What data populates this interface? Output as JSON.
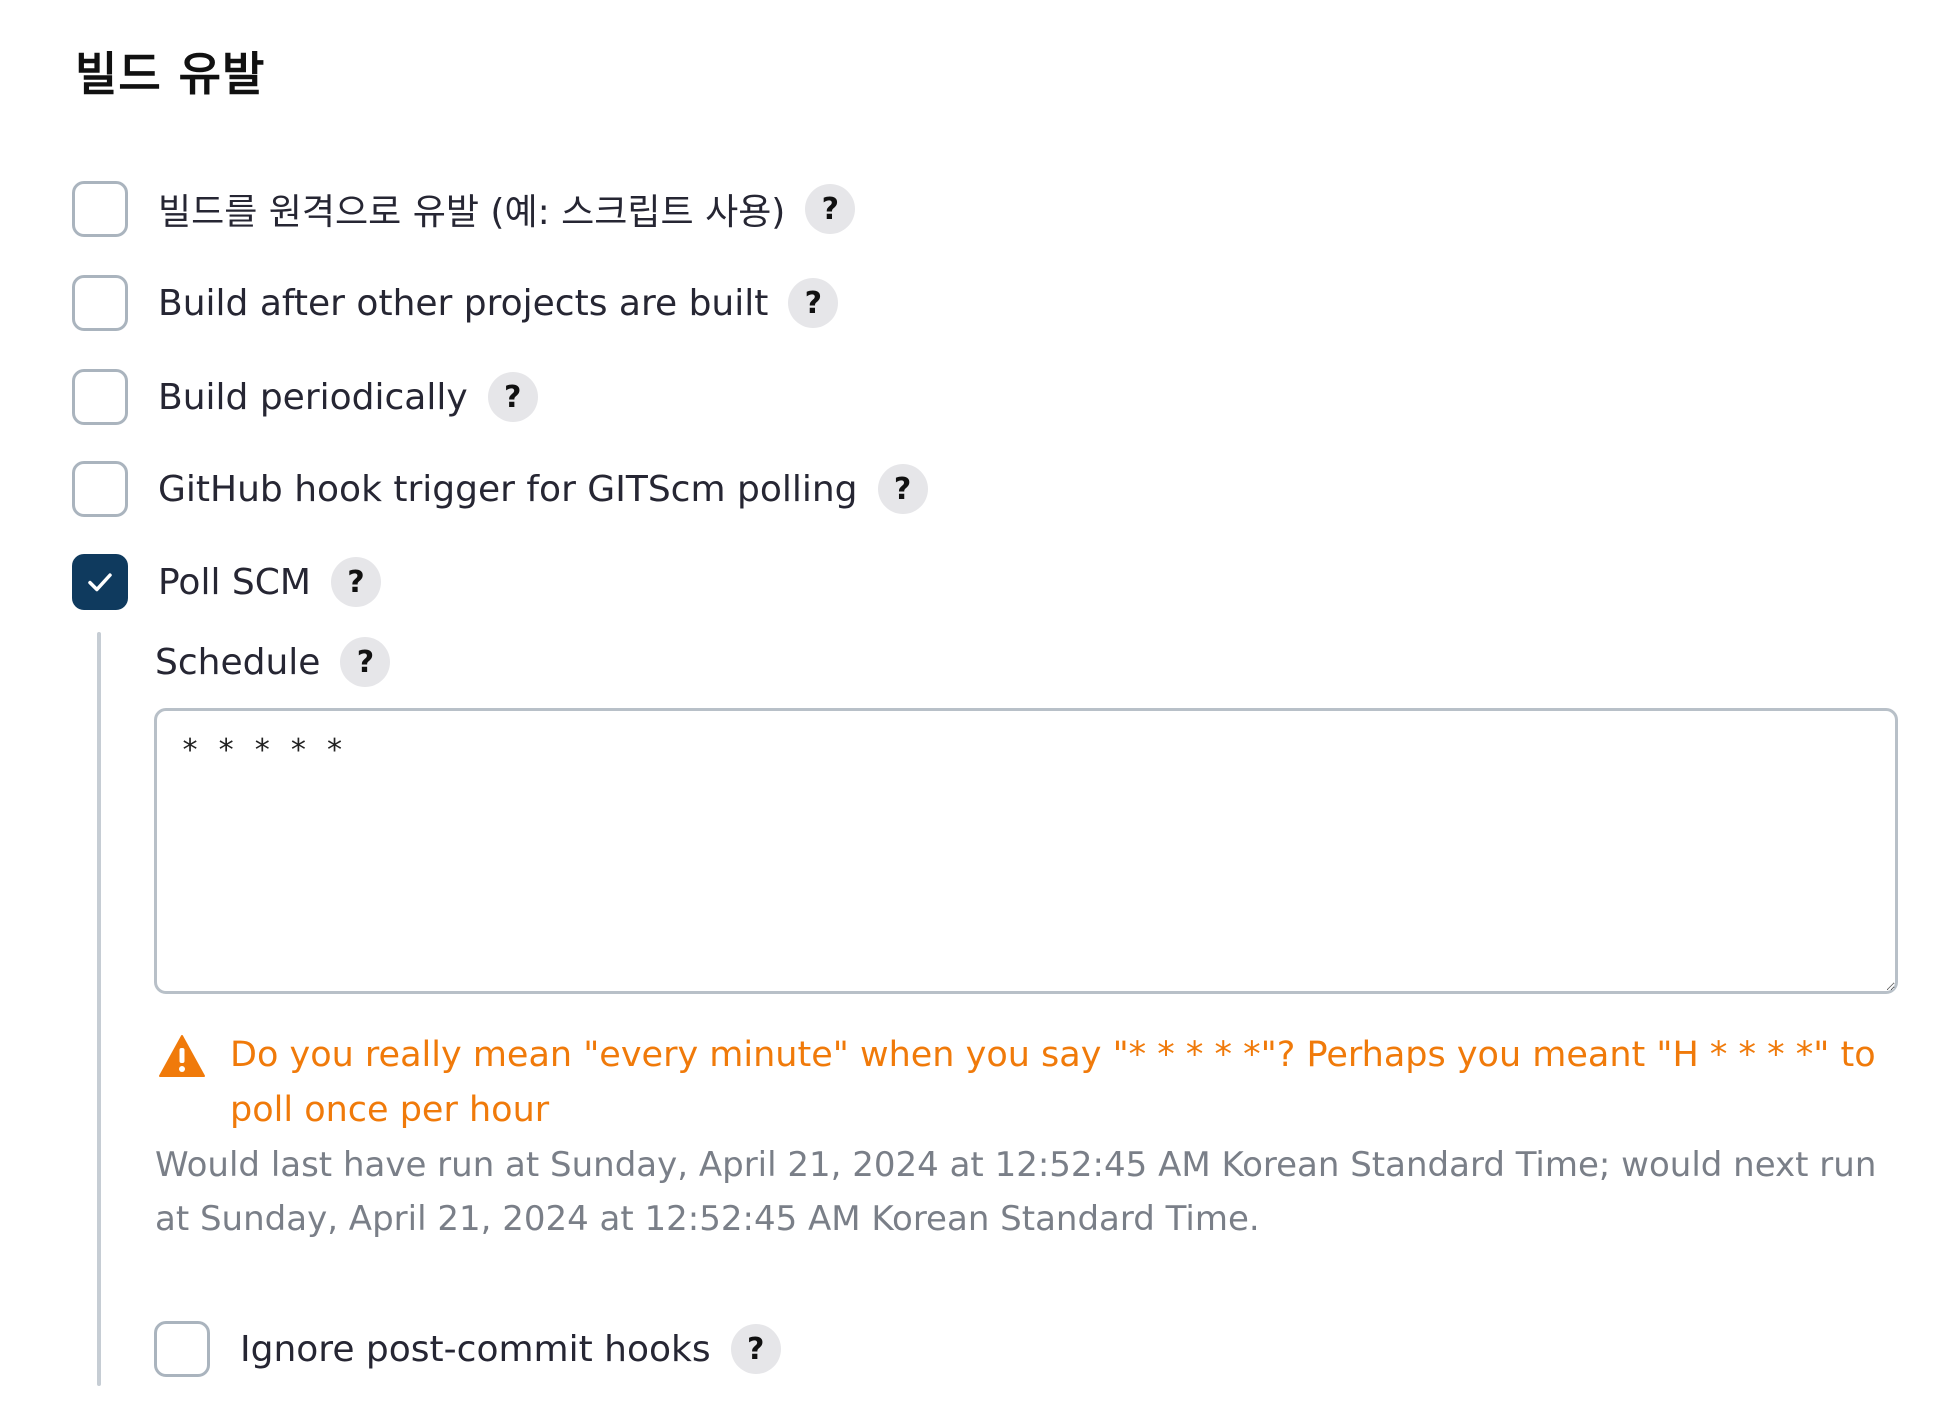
{
  "section": {
    "title": "빌드 유발"
  },
  "triggers": [
    {
      "label": "빌드를 원격으로 유발 (예: 스크립트 사용)",
      "help": "?",
      "checked": false
    },
    {
      "label": "Build after other projects are built",
      "help": "?",
      "checked": false
    },
    {
      "label": "Build periodically",
      "help": "?",
      "checked": false
    },
    {
      "label": "GitHub hook trigger for GITScm polling",
      "help": "?",
      "checked": false
    },
    {
      "label": "Poll SCM",
      "help": "?",
      "checked": true
    }
  ],
  "poll_scm": {
    "schedule_label": "Schedule",
    "schedule_help": "?",
    "schedule_value": "* * * * *",
    "warning": "Do you really mean \"every minute\" when you say \"* * * * *\"? Perhaps you meant \"H * * * *\" to poll once per hour",
    "info": "Would last have run at Sunday, April 21, 2024 at 12:52:45 AM Korean Standard Time; would next run at Sunday, April 21, 2024 at 12:52:45 AM Korean Standard Time.",
    "ignore_hooks_label": "Ignore post-commit hooks",
    "ignore_hooks_help": "?",
    "ignore_hooks_checked": false
  },
  "colors": {
    "checkbox_checked": "#0f3a5e",
    "warning": "#f07a0a",
    "info_text": "#7a7f88"
  },
  "icons": {
    "checkmark": "check-icon",
    "warning": "warning-triangle-icon",
    "help": "help-icon"
  }
}
